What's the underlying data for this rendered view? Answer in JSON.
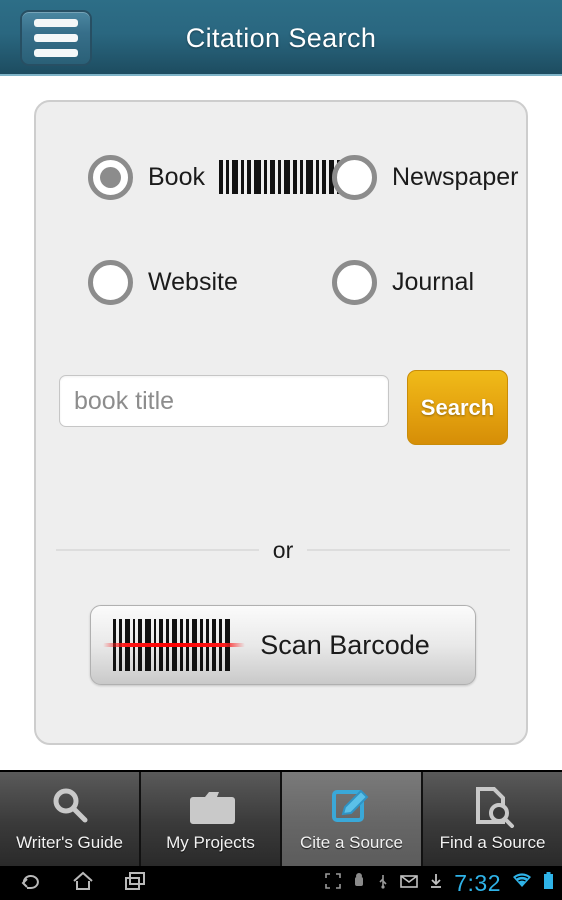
{
  "header": {
    "title": "Citation Search",
    "menu_icon": "hamburger-menu-icon",
    "bg_start": "#2d6e87",
    "bg_end": "#1d4c60"
  },
  "form": {
    "source_types": [
      {
        "label": "Book",
        "checked": true,
        "icon": "barcode-icon"
      },
      {
        "label": "Newspaper",
        "checked": false,
        "icon": ""
      },
      {
        "label": "Website",
        "checked": false,
        "icon": ""
      },
      {
        "label": "Journal",
        "checked": false,
        "icon": ""
      }
    ],
    "search_input": {
      "value": "",
      "placeholder": "book title"
    },
    "search_button": {
      "label": "Search",
      "color": "#e5a410"
    },
    "divider_text": "or",
    "scan_button": {
      "label": "Scan Barcode",
      "icon": "barcode-scan-icon",
      "laser_color": "#ff0000"
    }
  },
  "tabbar": {
    "items": [
      {
        "label": "Writer's Guide",
        "icon": "magnifier-icon",
        "active": false
      },
      {
        "label": "My Projects",
        "icon": "folder-icon",
        "active": false
      },
      {
        "label": "Cite a Source",
        "icon": "pencil-note-icon",
        "active": true
      },
      {
        "label": "Find a Source",
        "icon": "document-search-icon",
        "active": false
      }
    ],
    "active_color": "#666666"
  },
  "systembar": {
    "nav": [
      {
        "icon": "back-icon"
      },
      {
        "icon": "home-icon"
      },
      {
        "icon": "recents-icon"
      }
    ],
    "status_icons": [
      {
        "icon": "expand-icon"
      },
      {
        "icon": "android-icon"
      },
      {
        "icon": "usb-icon"
      },
      {
        "icon": "mail-icon"
      },
      {
        "icon": "download-icon"
      }
    ],
    "time": "7:32",
    "time_color": "#2fb3e8",
    "wifi_icon": "wifi-icon",
    "battery_icon": "battery-icon"
  }
}
